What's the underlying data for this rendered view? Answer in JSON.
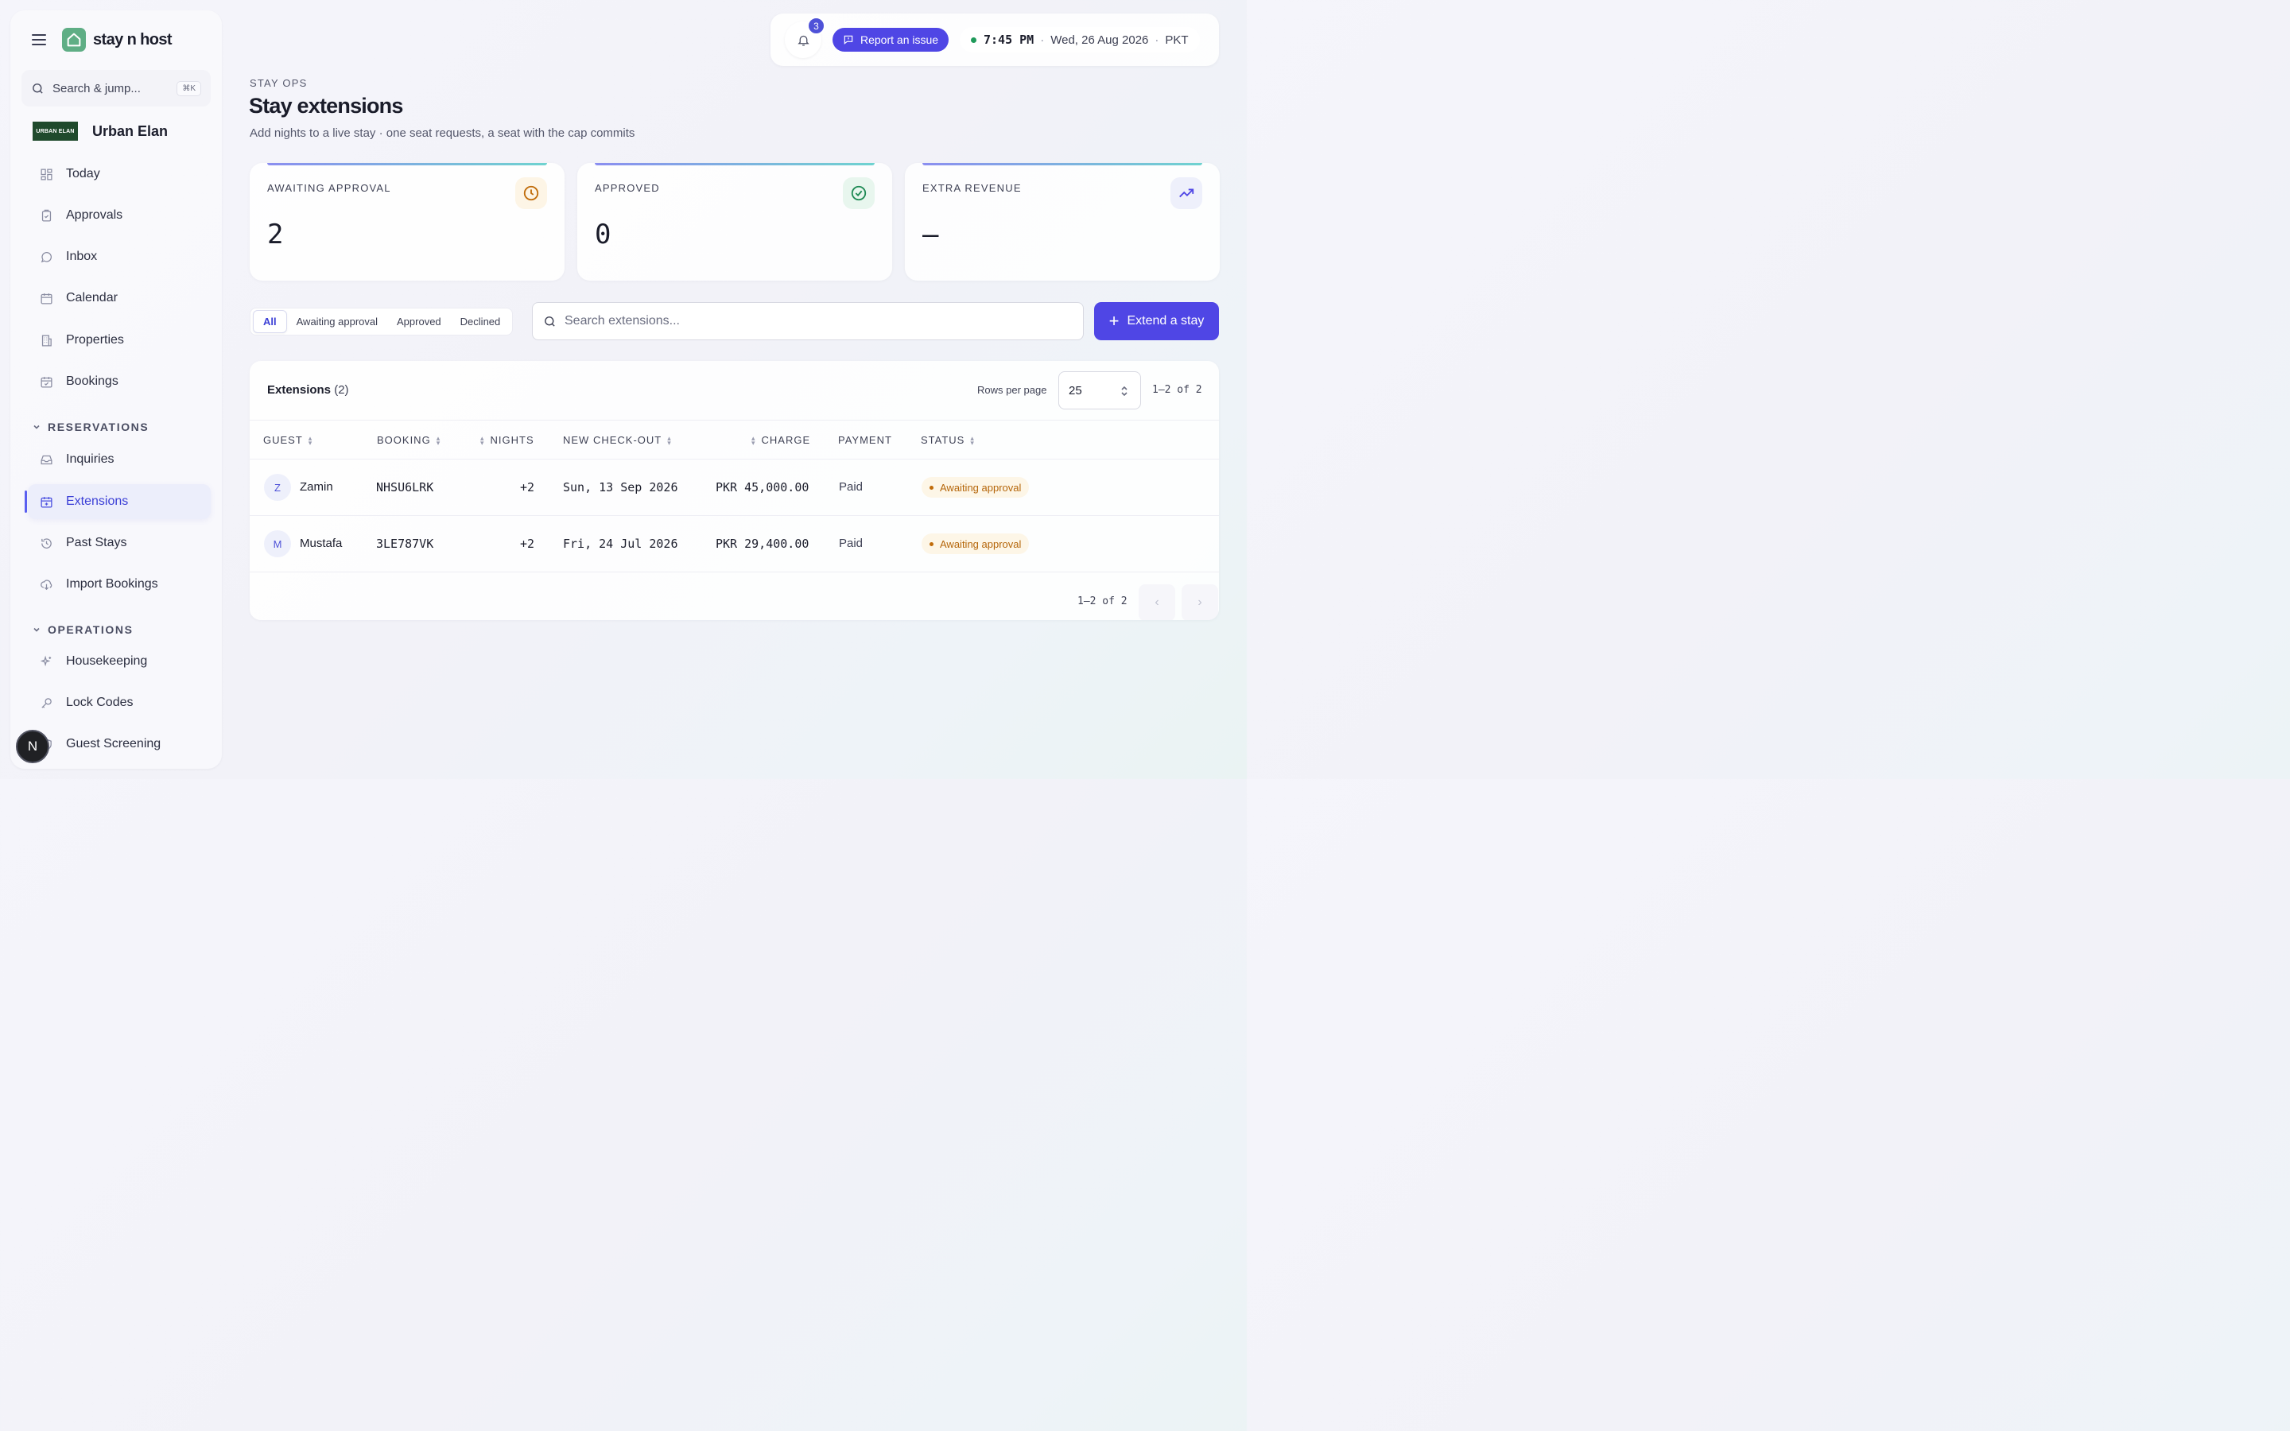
{
  "sidebar": {
    "brand": "stay n host",
    "search_placeholder": "Search & jump...",
    "search_kbd": "⌘K",
    "org_logo_text": "URBAN ELAN",
    "org_name": "Urban Elan",
    "items": [
      {
        "label": "Today",
        "icon": "grid-icon"
      },
      {
        "label": "Approvals",
        "icon": "clipboard-check-icon"
      },
      {
        "label": "Inbox",
        "icon": "chat-bubble-icon"
      },
      {
        "label": "Calendar",
        "icon": "calendar-icon"
      },
      {
        "label": "Properties",
        "icon": "building-icon"
      },
      {
        "label": "Bookings",
        "icon": "calendar-check-icon"
      }
    ],
    "section_reservations": "RESERVATIONS",
    "reservation_items": [
      {
        "label": "Inquiries",
        "icon": "inbox-tray-icon"
      },
      {
        "label": "Extensions",
        "icon": "calendar-plus-icon",
        "active": true
      },
      {
        "label": "Past Stays",
        "icon": "history-icon"
      },
      {
        "label": "Import Bookings",
        "icon": "cloud-download-icon"
      }
    ],
    "section_operations": "OPERATIONS",
    "operation_items": [
      {
        "label": "Housekeeping",
        "icon": "sparkles-icon"
      },
      {
        "label": "Lock Codes",
        "icon": "key-icon"
      },
      {
        "label": "Guest Screening",
        "icon": "shield-icon"
      }
    ],
    "user_initial": "N"
  },
  "topbar": {
    "notification_count": "3",
    "report_label": "Report an issue",
    "time": "7:45 PM",
    "date": "Wed, 26 Aug 2026",
    "timezone": "PKT",
    "separator": "·"
  },
  "header": {
    "eyebrow": "STAY OPS",
    "title": "Stay extensions",
    "subtitle": "Add nights to a live stay · one seat requests, a seat with the cap commits"
  },
  "stats": [
    {
      "label": "AWAITING APPROVAL",
      "value": "2",
      "icon": "clock-icon"
    },
    {
      "label": "APPROVED",
      "value": "0",
      "icon": "check-circle-icon"
    },
    {
      "label": "EXTRA REVENUE",
      "value": "—",
      "icon": "trending-up-icon"
    }
  ],
  "filters": [
    "All",
    "Awaiting approval",
    "Approved",
    "Declined"
  ],
  "active_filter": "All",
  "search_placeholder": "Search extensions...",
  "extend_label": "Extend a stay",
  "table": {
    "title": "Extensions",
    "count": "(2)",
    "rows_per_page_label": "Rows per page",
    "rows_per_page": "25",
    "range": "1–2 of 2",
    "columns": [
      "GUEST",
      "BOOKING",
      "NIGHTS",
      "NEW CHECK-OUT",
      "CHARGE",
      "PAYMENT",
      "STATUS"
    ],
    "rows": [
      {
        "initial": "Z",
        "guest": "Zamin",
        "booking": "NHSU6LRK",
        "nights": "+2",
        "checkout": "Sun, 13 Sep 2026",
        "charge": "PKR 45,000.00",
        "payment": "Paid",
        "status": "Awaiting approval"
      },
      {
        "initial": "M",
        "guest": "Mustafa",
        "booking": "3LE787VK",
        "nights": "+2",
        "checkout": "Fri, 24 Jul 2026",
        "charge": "PKR 29,400.00",
        "payment": "Paid",
        "status": "Awaiting approval"
      }
    ]
  },
  "colors": {
    "accent": "#4f46e5",
    "status_awaiting": "#b5660a",
    "online": "#1f9a5a"
  }
}
